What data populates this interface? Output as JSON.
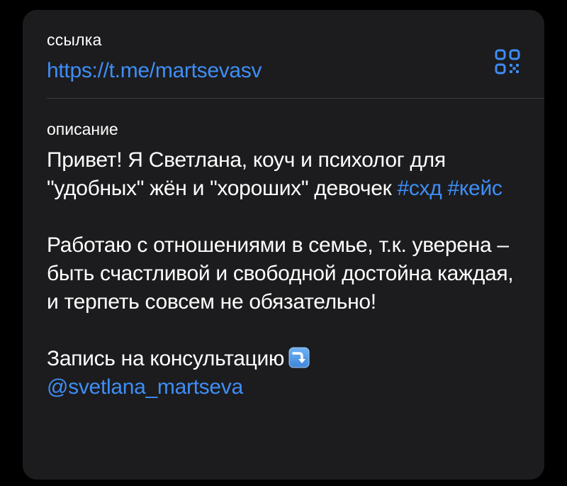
{
  "link": {
    "label": "ссылка",
    "url": "https://t.me/martsevasv"
  },
  "qr": {
    "icon": "qr-code-icon",
    "color": "#3e8ef7"
  },
  "description": {
    "label": "описание",
    "line1_text": "Привет! Я Светлана, коуч и психолог для \"удобных\" жён и \"хороших\" девочек ",
    "tag1": "#схд",
    "tag2": "#кейс",
    "paragraph2": "Работаю с отношениями в семье, т.к. уверена – быть счастливой и свободной достойна каждая, и терпеть совсем не обязательно!",
    "booking_text": "Запись на консультацию",
    "booking_emoji": "right-arrow-curving-down-icon",
    "mention": "@svetlana_martseva"
  },
  "colors": {
    "background": "#000000",
    "card": "#1c1c1e",
    "text": "#ffffff",
    "accent": "#3e8ef7",
    "divider": "#3a3a3c"
  }
}
